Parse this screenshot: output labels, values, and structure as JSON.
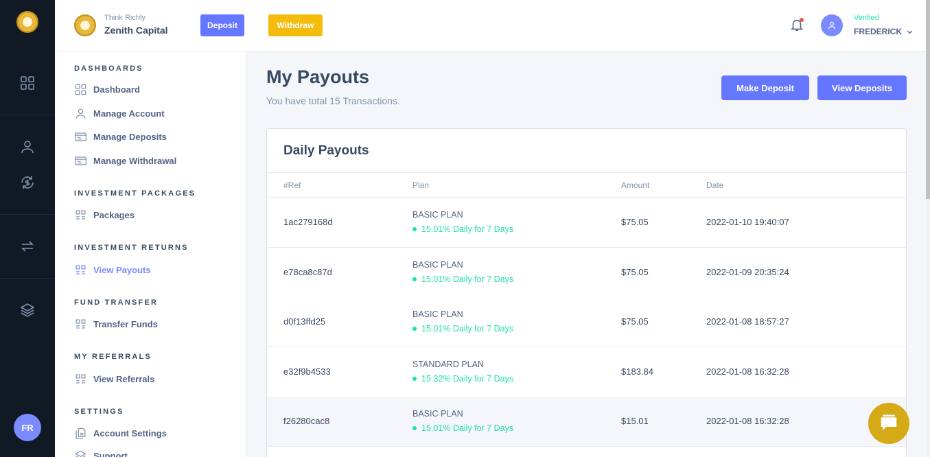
{
  "brand": {
    "tagline": "Think Richly",
    "name": "Zenith Capital"
  },
  "header": {
    "deposit_label": "Deposit",
    "withdraw_label": "Withdraw",
    "user_status": "Verified",
    "user_name": "FREDERICK"
  },
  "rail": {
    "avatar_initials": "FR"
  },
  "sidebar": {
    "sections": [
      {
        "heading": "DASHBOARDS",
        "items": [
          "Dashboard",
          "Manage Account",
          "Manage Deposits",
          "Manage Withdrawal"
        ]
      },
      {
        "heading": "INVESTMENT PACKAGES",
        "items": [
          "Packages"
        ]
      },
      {
        "heading": "INVESTMENT RETURNS",
        "items": [
          "View Payouts"
        ]
      },
      {
        "heading": "FUND TRANSFER",
        "items": [
          "Transfer Funds"
        ]
      },
      {
        "heading": "MY REFERRALS",
        "items": [
          "View Referrals"
        ]
      },
      {
        "heading": "SETTINGS",
        "items": [
          "Account Settings",
          "Support"
        ]
      }
    ]
  },
  "main": {
    "title": "My Payouts",
    "subtitle": "You have total 15 Transactions.",
    "make_deposit_label": "Make Deposit",
    "view_deposits_label": "View Deposits",
    "card_title": "Daily Payouts",
    "columns": [
      "#Ref",
      "Plan",
      "Amount",
      "Date"
    ],
    "rows": [
      {
        "ref": "1ac279168d",
        "plan": "BASIC PLAN",
        "rate": "15.01% Daily for 7 Days",
        "amount": "$75.05",
        "date": "2022-01-10 19:40:07"
      },
      {
        "ref": "e78ca8c87d",
        "plan": "BASIC PLAN",
        "rate": "15.01% Daily for 7 Days",
        "amount": "$75.05",
        "date": "2022-01-09 20:35:24"
      },
      {
        "ref": "d0f13ffd25",
        "plan": "BASIC PLAN",
        "rate": "15.01% Daily for 7 Days",
        "amount": "$75.05",
        "date": "2022-01-08 18:57:27"
      },
      {
        "ref": "e32f9b4533",
        "plan": "STANDARD PLAN",
        "rate": "15.32% Daily for 7 Days",
        "amount": "$183.84",
        "date": "2022-01-08 16:32:28"
      },
      {
        "ref": "f26280cac8",
        "plan": "BASIC PLAN",
        "rate": "15.01% Daily for 7 Days",
        "amount": "$15.01",
        "date": "2022-01-08 16:32:28"
      }
    ]
  },
  "colors": {
    "primary": "#6576ff",
    "warning": "#f4bd0e",
    "success": "#1ee0ac",
    "rail": "#101924"
  }
}
